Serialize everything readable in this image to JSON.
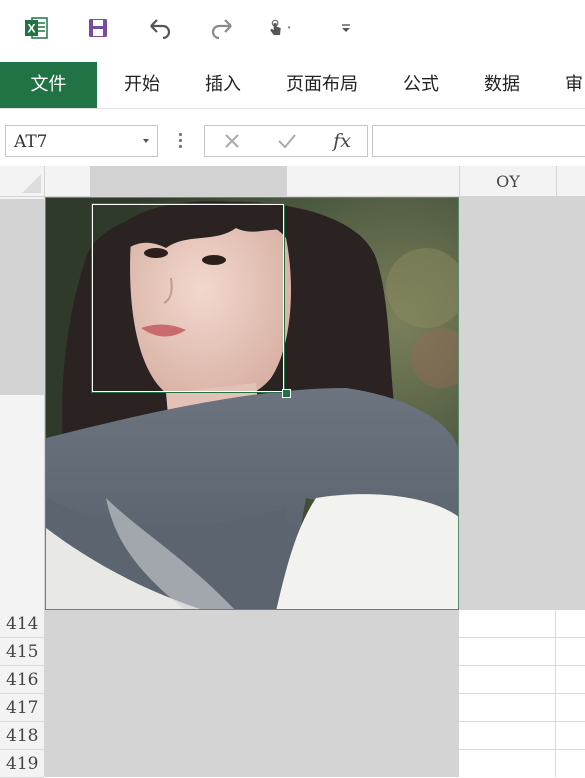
{
  "toolbar": {
    "icons": [
      "excel-logo-icon",
      "save-icon",
      "undo-icon",
      "redo-icon",
      "touch-mode-icon",
      "customize-toolbar-icon"
    ],
    "accent_color": "#217346"
  },
  "ribbon": {
    "tabs": [
      {
        "label": "文件",
        "active": true
      },
      {
        "label": "开始"
      },
      {
        "label": "插入"
      },
      {
        "label": "页面布局"
      },
      {
        "label": "公式"
      },
      {
        "label": "数据"
      },
      {
        "label": "审阅"
      }
    ]
  },
  "formula_bar": {
    "name_box": "AT7",
    "fx_label": "fx",
    "formula": ""
  },
  "grid": {
    "column_header": "OY",
    "row_numbers": [
      "414",
      "415",
      "416",
      "417",
      "418",
      "419"
    ]
  }
}
